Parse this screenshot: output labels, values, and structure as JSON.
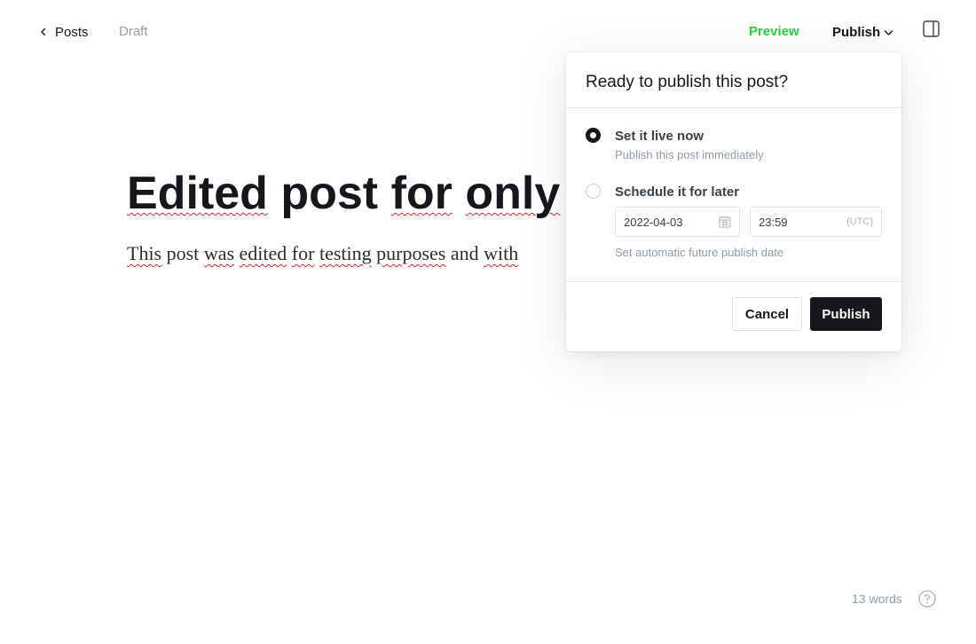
{
  "topbar": {
    "back_label": "Posts",
    "status": "Draft",
    "preview_label": "Preview",
    "publish_menu_label": "Publish"
  },
  "editor": {
    "title_words": [
      "Edited",
      "post",
      "for",
      "only"
    ],
    "body_words": [
      "This",
      "post",
      "was",
      "edited",
      "for",
      "testing",
      "purposes",
      "and",
      "with"
    ]
  },
  "publish_popover": {
    "title": "Ready to publish this post?",
    "option_now": {
      "label": "Set it live now",
      "description": "Publish this post immediately",
      "selected": true
    },
    "option_later": {
      "label": "Schedule it for later",
      "date_value": "2022-04-03",
      "time_value": "23:59",
      "timezone": "(UTC)",
      "hint": "Set automatic future publish date",
      "selected": false
    },
    "cancel_label": "Cancel",
    "publish_label": "Publish"
  },
  "footer": {
    "word_count": "13 words"
  },
  "colors": {
    "accent_green": "#30cf43",
    "primary_dark": "#15171a",
    "muted": "#8e9cac"
  },
  "icons": [
    "chevron-left-icon",
    "chevron-down-icon",
    "sidebar-toggle-icon",
    "calendar-icon",
    "help-icon"
  ]
}
